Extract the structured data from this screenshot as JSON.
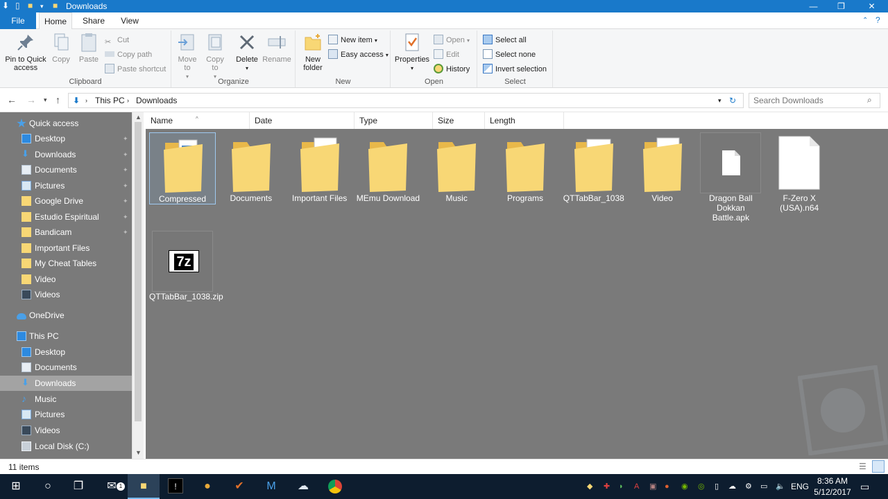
{
  "window": {
    "title": "Downloads",
    "minimize_glyph": "—",
    "maximize_glyph": "❐",
    "close_glyph": "✕"
  },
  "ribbon_tabs": [
    {
      "label": "File"
    },
    {
      "label": "Home"
    },
    {
      "label": "Share"
    },
    {
      "label": "View"
    }
  ],
  "ribbon": {
    "clipboard": {
      "label": "Clipboard",
      "pin": "Pin to Quick access",
      "copy": "Copy",
      "paste": "Paste",
      "cut": "Cut",
      "copy_path": "Copy path",
      "paste_shortcut": "Paste shortcut"
    },
    "organize": {
      "label": "Organize",
      "move_to": "Move to",
      "copy_to": "Copy to",
      "delete": "Delete",
      "rename": "Rename"
    },
    "new": {
      "label": "New",
      "new_folder": "New folder",
      "new_item": "New item",
      "easy_access": "Easy access"
    },
    "open": {
      "label": "Open",
      "properties": "Properties",
      "open": "Open",
      "edit": "Edit",
      "history": "History"
    },
    "select": {
      "label": "Select",
      "select_all": "Select all",
      "select_none": "Select none",
      "invert_selection": "Invert selection"
    }
  },
  "address": {
    "crumbs": [
      "This PC",
      "Downloads"
    ],
    "search_placeholder": "Search Downloads"
  },
  "nav_pane": [
    {
      "label": "Quick access",
      "icon": "star-icon",
      "pinned": false,
      "level": 0
    },
    {
      "label": "Desktop",
      "icon": "desktop-icon",
      "pinned": true,
      "level": 1
    },
    {
      "label": "Downloads",
      "icon": "download-icon",
      "pinned": true,
      "level": 1
    },
    {
      "label": "Documents",
      "icon": "documents-icon",
      "pinned": true,
      "level": 1
    },
    {
      "label": "Pictures",
      "icon": "pictures-icon",
      "pinned": true,
      "level": 1
    },
    {
      "label": "Google Drive",
      "icon": "folder-icon",
      "pinned": true,
      "level": 1
    },
    {
      "label": "Estudio Espiritual",
      "icon": "folder-icon",
      "pinned": true,
      "level": 1
    },
    {
      "label": "Bandicam",
      "icon": "folder-icon",
      "pinned": true,
      "level": 1
    },
    {
      "label": "Important Files",
      "icon": "folder-icon",
      "pinned": false,
      "level": 1
    },
    {
      "label": "My Cheat Tables",
      "icon": "folder-icon",
      "pinned": false,
      "level": 1
    },
    {
      "label": "Video",
      "icon": "folder-icon",
      "pinned": false,
      "level": 1
    },
    {
      "label": "Videos",
      "icon": "videos-icon",
      "pinned": false,
      "level": 1
    },
    {
      "label": "OneDrive",
      "icon": "cloud-icon",
      "pinned": false,
      "level": 0
    },
    {
      "label": "This PC",
      "icon": "computer-icon",
      "pinned": false,
      "level": 0
    },
    {
      "label": "Desktop",
      "icon": "desktop-icon",
      "pinned": false,
      "level": 1
    },
    {
      "label": "Documents",
      "icon": "documents-icon",
      "pinned": false,
      "level": 1
    },
    {
      "label": "Downloads",
      "icon": "download-icon",
      "pinned": false,
      "level": 1,
      "selected": true
    },
    {
      "label": "Music",
      "icon": "music-icon",
      "pinned": false,
      "level": 1
    },
    {
      "label": "Pictures",
      "icon": "pictures-icon",
      "pinned": false,
      "level": 1
    },
    {
      "label": "Videos",
      "icon": "videos-icon",
      "pinned": false,
      "level": 1
    },
    {
      "label": "Local Disk (C:)",
      "icon": "disk-icon",
      "pinned": false,
      "level": 1
    }
  ],
  "columns": [
    "Name",
    "Date",
    "Type",
    "Size",
    "Length"
  ],
  "files": [
    {
      "name": "Compressed",
      "kind": "folder-docs",
      "selected": true
    },
    {
      "name": "Documents",
      "kind": "folder"
    },
    {
      "name": "Important Files",
      "kind": "folder-vs"
    },
    {
      "name": "MEmu Download",
      "kind": "folder"
    },
    {
      "name": "Music",
      "kind": "folder"
    },
    {
      "name": "Programs",
      "kind": "folder"
    },
    {
      "name": "QTTabBar_1038",
      "kind": "folder-chrome"
    },
    {
      "name": "Video",
      "kind": "folder-sketch"
    },
    {
      "name": "Dragon Ball Dokkan Battle.apk",
      "kind": "file-small"
    },
    {
      "name": "F-Zero X (USA).n64",
      "kind": "file-large"
    },
    {
      "name": "QTTabBar_1038.zip",
      "kind": "zip-7z"
    }
  ],
  "zip_icon_text": "7z",
  "status": {
    "item_count": "11 items"
  },
  "taskbar": {
    "language": "ENG",
    "time": "8:36 AM",
    "date": "5/12/2017",
    "mail_badge": "1"
  },
  "colors": {
    "accent": "#1979ca",
    "pane_bg": "#7a7a7a",
    "taskbar_bg": "#0d1d2f",
    "folder": "#f8d775",
    "folder_dark": "#e8b84a"
  }
}
